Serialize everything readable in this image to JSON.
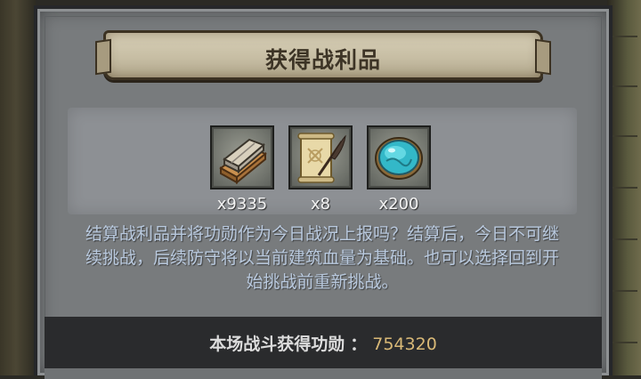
{
  "dialog": {
    "title": "获得战利品",
    "items": [
      {
        "icon": "stone-bricks-icon",
        "count": "x9335"
      },
      {
        "icon": "scroll-quill-icon",
        "count": "x8"
      },
      {
        "icon": "turquoise-gem-icon",
        "count": "x200"
      }
    ],
    "message": "结算战利品并将功勋作为今日战况上报吗？结算后，今日不可继续挑战，后续防守将以当前建筑血量为基础。也可以选择回到开始挑战前重新挑战。",
    "reward": {
      "label": "本场战斗获得功勋",
      "separator": "：",
      "value": "754320"
    },
    "colors": {
      "panel": "#787b7d",
      "message_text": "#b9c9de",
      "reward_value": "#d9b977"
    }
  }
}
